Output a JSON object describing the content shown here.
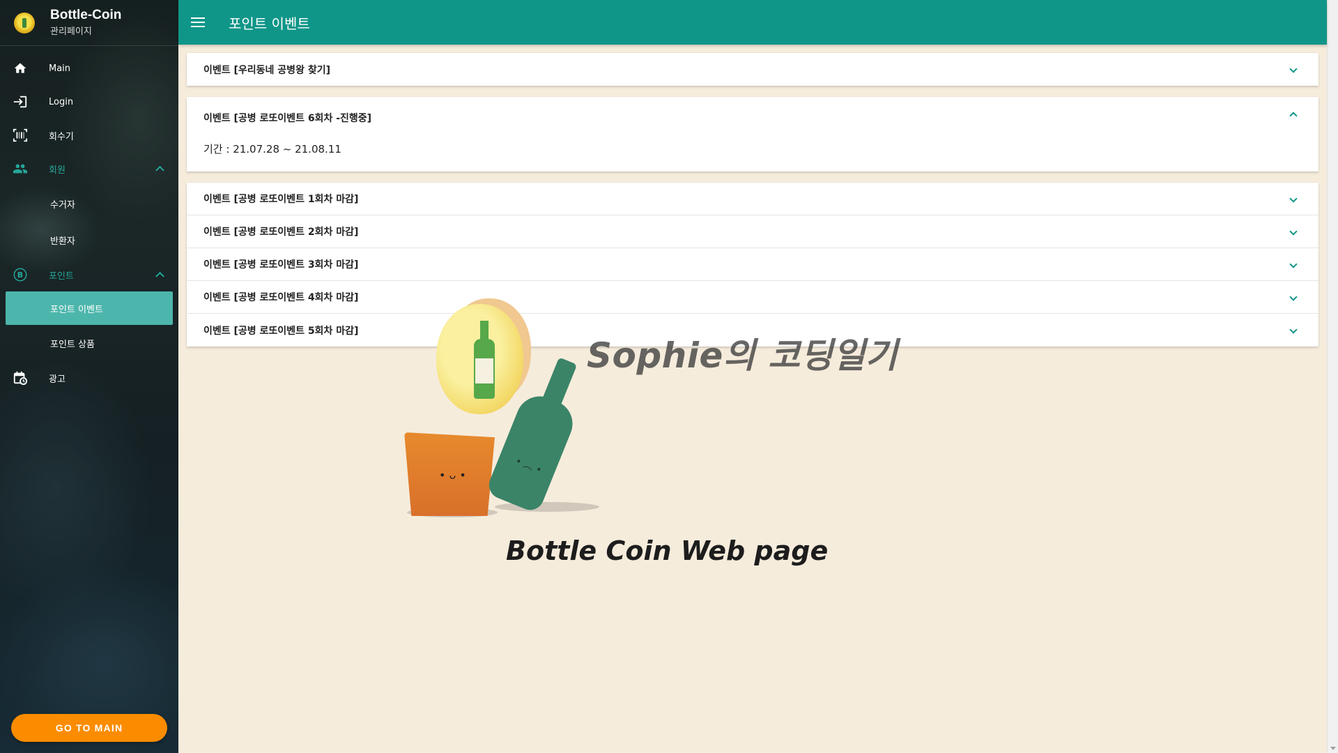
{
  "brand": {
    "title": "Bottle-Coin",
    "subtitle": "관리페이지"
  },
  "nav": {
    "main": "Main",
    "login": "Login",
    "collector": "회수기",
    "members": {
      "label": "회원",
      "items": [
        "수거자",
        "반환자"
      ]
    },
    "points": {
      "label": "포인트",
      "items": [
        "포인트 이벤트",
        "포인트 상품"
      ],
      "active_index": 0
    },
    "ads": "광고"
  },
  "go_main_label": "GO TO MAIN",
  "topbar": {
    "title": "포인트 이벤트"
  },
  "events": {
    "first": {
      "title": "이벤트 [우리동네 공병왕 찾기]",
      "expanded": false
    },
    "open": {
      "title": "이벤트 [공병 로또이벤트 6회차 -진행중]",
      "expanded": true,
      "period": "기간 : 21.07.28 ~ 21.08.11"
    },
    "list": [
      "이벤트 [공병 로또이벤트 1회차 마감]",
      "이벤트 [공병 로또이벤트 2회차 마감]",
      "이벤트 [공병 로또이벤트 3회차 마감]",
      "이벤트 [공병 로또이벤트 4회차 마감]",
      "이벤트 [공병 로또이벤트 5회차 마감]"
    ]
  },
  "watermark": {
    "title": "Sophie의 코딩일기",
    "subtitle": "Bottle Coin Web page"
  },
  "colors": {
    "primary": "#0f9688",
    "accent": "#fb8c00",
    "active_nav": "#4db6ac",
    "background": "#f6ecdc"
  },
  "icons": [
    "home-icon",
    "login-icon",
    "barcode-icon",
    "people-icon",
    "bitcoin-icon",
    "calendar-icon",
    "menu-icon",
    "chevron-down-icon",
    "chevron-up-icon"
  ]
}
